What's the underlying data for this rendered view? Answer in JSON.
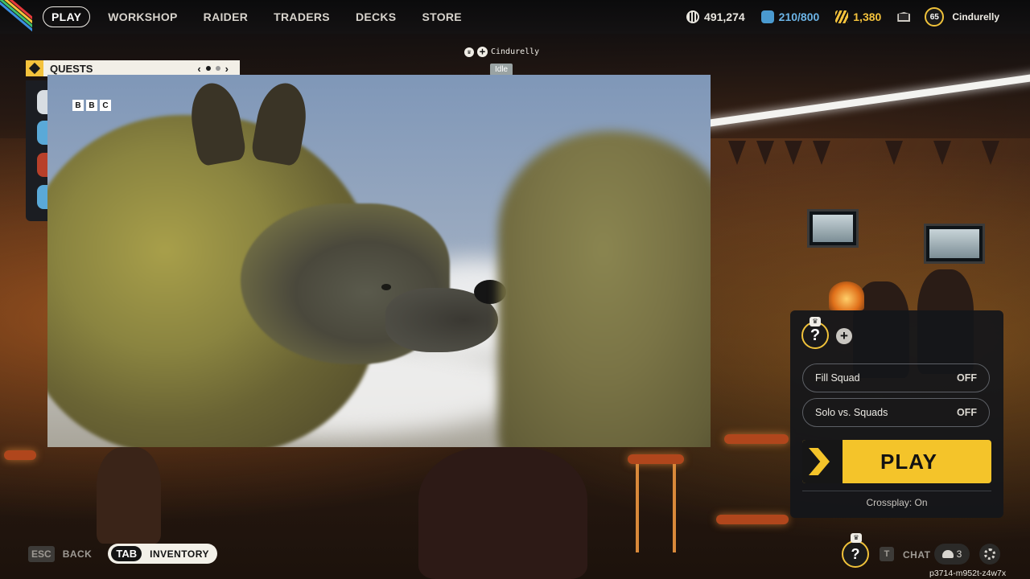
{
  "nav": {
    "items": [
      "PLAY",
      "WORKSHOP",
      "RAIDER",
      "TRADERS",
      "DECKS",
      "STORE"
    ],
    "active": "PLAY"
  },
  "currencies": {
    "coins": "491,274",
    "tokens": "210/800",
    "bars": "1,380"
  },
  "player": {
    "level": "65",
    "name": "Cindurelly"
  },
  "quests": {
    "title": "QUESTS",
    "prev": "‹",
    "next": "›"
  },
  "nameplate": {
    "name": "Cindurelly",
    "status": "Idle"
  },
  "video": {
    "logo_letters": [
      "B",
      "B",
      "C"
    ]
  },
  "squad": {
    "slot_symbol": "?",
    "add_symbol": "+",
    "fill_squad_label": "Fill Squad",
    "fill_squad_value": "OFF",
    "solo_label": "Solo vs. Squads",
    "solo_value": "OFF",
    "play_label": "PLAY",
    "crossplay": "Crossplay: On"
  },
  "bottom": {
    "esc_key": "ESC",
    "back_label": "BACK",
    "tab_key": "TAB",
    "inventory_label": "INVENTORY",
    "chat_key": "T",
    "chat_label": "CHAT",
    "friends_count": "3",
    "slot_symbol": "?"
  },
  "session_id": "p3714-m952t-z4w7x",
  "colors": {
    "accent": "#f4c42a",
    "token_blue": "#6cb4e6"
  }
}
